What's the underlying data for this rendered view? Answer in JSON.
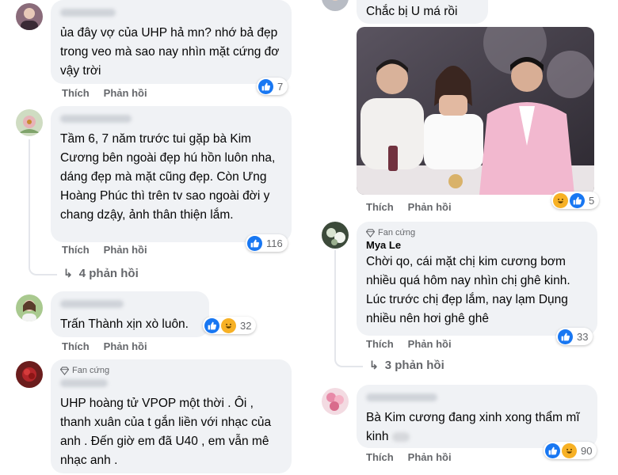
{
  "actions": {
    "like_label": "Thích",
    "reply_label": "Phản hồi"
  },
  "badge": {
    "fan_label": "Fan cứng",
    "icon": "diamond-icon"
  },
  "left": {
    "c1": {
      "text": "ủa đây vợ của UHP hả mn? nhớ bả đẹp trong veo mà sao nay nhìn mặt cứng đơ vậy trời",
      "reactions": "7"
    },
    "c2": {
      "text": "Tầm 6, 7 năm trước tui gặp bà Kim Cương bên ngoài đẹp hú hồn luôn nha, dáng đẹp mà mặt cũng đẹp. Còn Ưng Hoàng Phúc thì trên tv sao ngoài đời y chang dzậy, ảnh thân thiện lắm.",
      "reactions": "116",
      "replies": "4 phản hồi"
    },
    "c3": {
      "text": "Trấn Thành xịn xò luôn.",
      "reactions": "32"
    },
    "c4": {
      "text": "UHP hoàng tử VPOP một thời . Ôi , thanh xuân của t gắn liền với nhạc của anh . Đến giờ em đã U40 , em vẫn mê nhạc anh ."
    }
  },
  "right": {
    "c1": {
      "text": "Chắc bị U má rồi",
      "reactions": "5"
    },
    "c2": {
      "author": "Mya Le",
      "text": "Chời qo, cái mặt chị kim cương bơm nhiều quá hôm nay nhìn chị ghê kinh. Lúc trước chị đẹp lắm, nay lạm Dụng nhiều nên hơi ghê ghê",
      "reactions": "33",
      "replies": "3 phản hồi"
    },
    "c3": {
      "text": "Bà Kim cương đang xinh xong thẩm mĩ kinh",
      "reactions": "90"
    }
  }
}
